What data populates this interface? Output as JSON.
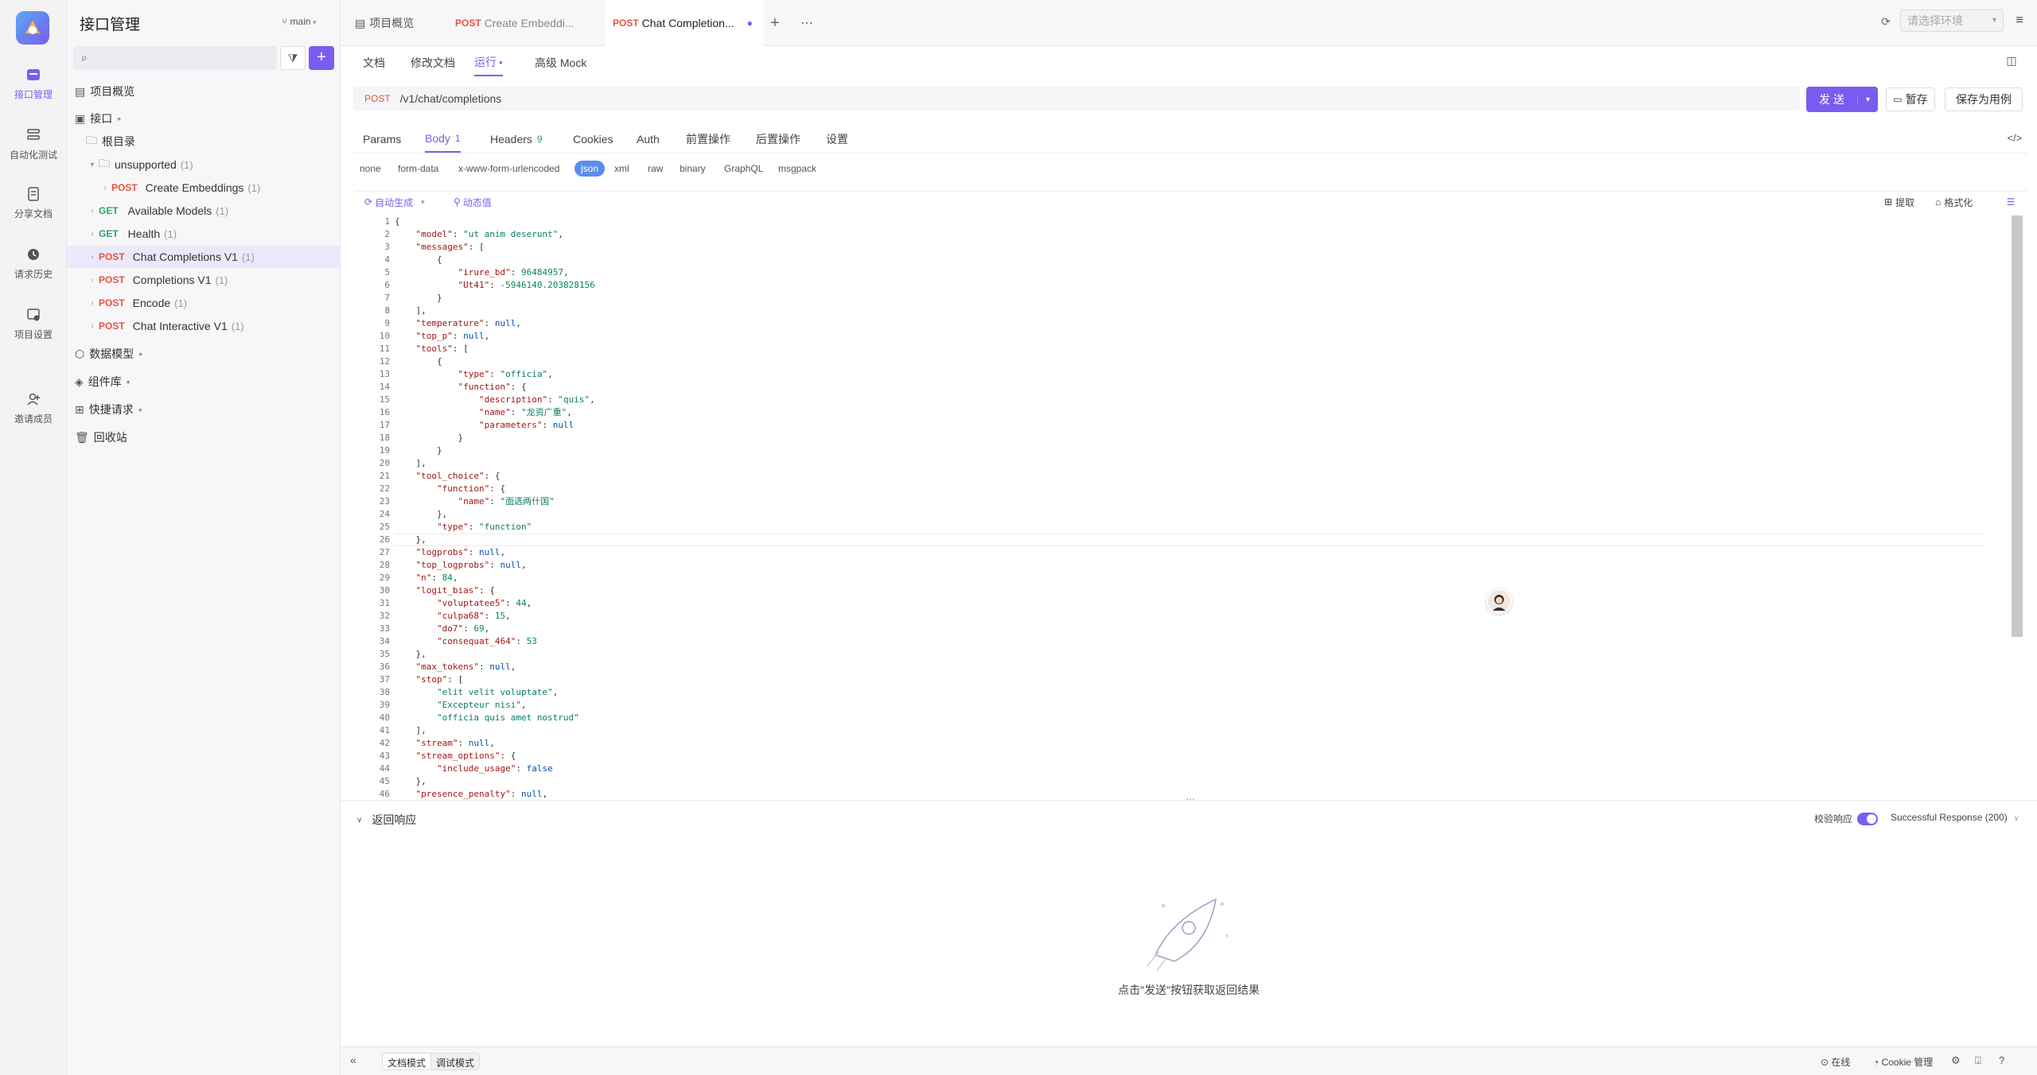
{
  "rail": {
    "items": [
      {
        "label": "接口管理",
        "icon": "api-icon",
        "active": true
      },
      {
        "label": "自动化测试",
        "icon": "automation-icon"
      },
      {
        "label": "分享文档",
        "icon": "share-doc-icon"
      },
      {
        "label": "请求历史",
        "icon": "history-icon"
      },
      {
        "label": "项目设置",
        "icon": "settings-icon"
      },
      {
        "label": "邀请成员",
        "icon": "invite-icon"
      }
    ]
  },
  "tree": {
    "title": "接口管理",
    "branch": "main",
    "search_placeholder": "",
    "overview": "项目概览",
    "api_root": "接口",
    "root_dir": "根目录",
    "folder": "unsupported",
    "folder_count": "(1)",
    "items": [
      {
        "method": "POST",
        "name": "Create Embeddings",
        "count": "(1)"
      },
      {
        "method": "GET",
        "name": "Available Models",
        "count": "(1)"
      },
      {
        "method": "GET",
        "name": "Health",
        "count": "(1)"
      },
      {
        "method": "POST",
        "name": "Chat Completions V1",
        "count": "(1)"
      },
      {
        "method": "POST",
        "name": "Completions V1",
        "count": "(1)"
      },
      {
        "method": "POST",
        "name": "Encode",
        "count": "(1)"
      },
      {
        "method": "POST",
        "name": "Chat Interactive V1",
        "count": "(1)"
      }
    ],
    "sections": [
      "数据模型",
      "组件库",
      "快捷请求",
      "回收站"
    ]
  },
  "tabs": {
    "overview": "项目概览",
    "tab1_method": "POST",
    "tab1_name": "Create Embeddi...",
    "tab2_method": "POST",
    "tab2_name": "Chat Completion...",
    "env_placeholder": "请选择环境"
  },
  "subnav": [
    "文档",
    "修改文档",
    "运行",
    "高级 Mock"
  ],
  "request": {
    "method": "POST",
    "path": "/v1/chat/completions",
    "send": "发 送",
    "save": "暂存",
    "save_case": "保存为用例"
  },
  "param_tabs": [
    {
      "label": "Params",
      "count": ""
    },
    {
      "label": "Body",
      "count": "1"
    },
    {
      "label": "Headers",
      "count": "9"
    },
    {
      "label": "Cookies",
      "count": ""
    },
    {
      "label": "Auth",
      "count": ""
    },
    {
      "label": "前置操作",
      "count": ""
    },
    {
      "label": "后置操作",
      "count": ""
    },
    {
      "label": "设置",
      "count": ""
    }
  ],
  "body_types": [
    "none",
    "form-data",
    "x-www-form-urlencoded",
    "json",
    "xml",
    "raw",
    "binary",
    "GraphQL",
    "msgpack"
  ],
  "editor": {
    "auto_gen": "自动生成",
    "dynamic": "动态值",
    "extract": "提取",
    "format": "格式化"
  },
  "code_lines": [
    "{",
    "    \"model\": \"ut anim deserunt\",",
    "    \"messages\": [",
    "        {",
    "            \"irure_bd\": 96484957,",
    "            \"Ut41\": -5946140.203828156",
    "        }",
    "    ],",
    "    \"temperature\": null,",
    "    \"top_p\": null,",
    "    \"tools\": [",
    "        {",
    "            \"type\": \"officia\",",
    "            \"function\": {",
    "                \"description\": \"quis\",",
    "                \"name\": \"龙资广重\",",
    "                \"parameters\": null",
    "            }",
    "        }",
    "    ],",
    "    \"tool_choice\": {",
    "        \"function\": {",
    "            \"name\": \"面选两什国\"",
    "        },",
    "        \"type\": \"function\"",
    "    },",
    "    \"logprobs\": null,",
    "    \"top_logprobs\": null,",
    "    \"n\": 84,",
    "    \"logit_bias\": {",
    "        \"voluptatee5\": 44,",
    "        \"culpa68\": 15,",
    "        \"do7\": 69,",
    "        \"consequat_464\": 53",
    "    },",
    "    \"max_tokens\": null,",
    "    \"stop\": [",
    "        \"elit velit voluptate\",",
    "        \"Excepteur nisi\",",
    "        \"officia quis amet nostrud\"",
    "    ],",
    "    \"stream\": null,",
    "    \"stream_options\": {",
    "        \"include_usage\": false",
    "    },",
    "    \"presence_penalty\": null,"
  ],
  "response": {
    "title": "返回响应",
    "validate": "校验响应",
    "status": "Successful Response (200)",
    "empty_hint": "点击\"发送\"按钮获取返回结果"
  },
  "bottom": {
    "doc_mode": "文档模式",
    "debug_mode": "调试模式",
    "online": "在线",
    "cookie": "Cookie 管理"
  },
  "colors": {
    "accent": "#7b5cf0",
    "post": "#e8543c",
    "get": "#2fa368"
  }
}
